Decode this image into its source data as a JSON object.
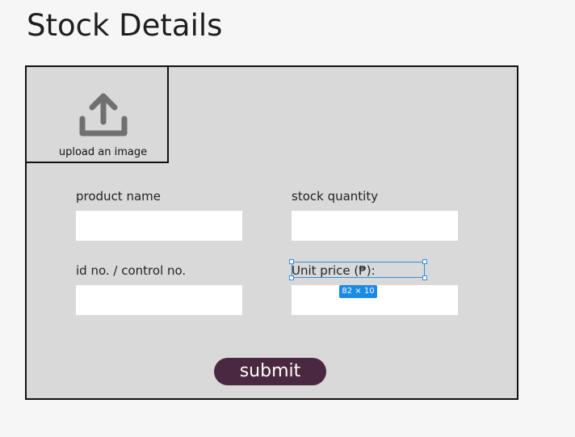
{
  "page": {
    "title": "Stock Details"
  },
  "upload": {
    "icon": "upload-icon",
    "label": "upload an image"
  },
  "fields": {
    "product_name": {
      "label": "product name",
      "value": "",
      "placeholder": ""
    },
    "stock_quantity": {
      "label": "stock quantity",
      "value": "",
      "placeholder": ""
    },
    "id_no": {
      "label": "id no. / control no.",
      "value": "",
      "placeholder": ""
    },
    "unit_price": {
      "label": "Unit price (₱):",
      "value": "",
      "placeholder": ""
    }
  },
  "selection": {
    "size_label": "82 × 10"
  },
  "submit": {
    "label": "submit"
  },
  "colors": {
    "frame_bg": "#d9d9d9",
    "button_bg": "#4b2841",
    "selection_accent": "#1a8ae6"
  }
}
